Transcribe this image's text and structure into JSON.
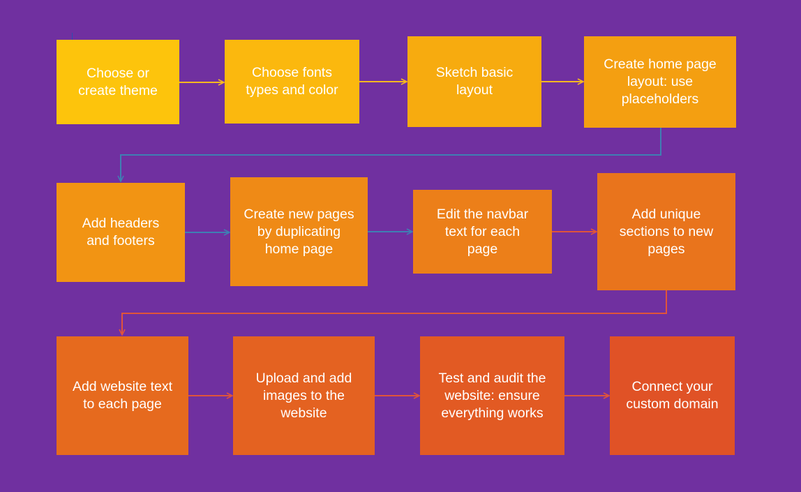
{
  "diagram": {
    "title": "",
    "background_color": "#7030a0",
    "steps": [
      {
        "id": 1,
        "label": "Choose or create theme",
        "lines": [
          "Choose or",
          "create theme"
        ],
        "color": "#fdc40c"
      },
      {
        "id": 2,
        "label": "Choose fonts types and color",
        "lines": [
          "Choose fonts",
          "types and color"
        ],
        "color": "#fbb80e"
      },
      {
        "id": 3,
        "label": "Sketch basic layout",
        "lines": [
          "Sketch basic",
          "layout"
        ],
        "color": "#f7ab0f"
      },
      {
        "id": 4,
        "label": "Create home page layout: use placeholders",
        "lines": [
          "Create home page",
          "layout: use",
          "placeholders"
        ],
        "color": "#f49f11"
      },
      {
        "id": 5,
        "label": "Add headers and footers",
        "lines": [
          "Add headers",
          "and footers"
        ],
        "color": "#f29413"
      },
      {
        "id": 6,
        "label": "Create new pages by duplicating home page",
        "lines": [
          "Create new pages",
          "by duplicating",
          "home page"
        ],
        "color": "#ef8a16"
      },
      {
        "id": 7,
        "label": "Edit the navbar text for each page",
        "lines": [
          "Edit the navbar",
          "text for each",
          "page"
        ],
        "color": "#ec7f19"
      },
      {
        "id": 8,
        "label": "Add unique sections to new pages",
        "lines": [
          "Add unique",
          "sections to new",
          "pages"
        ],
        "color": "#e9741c"
      },
      {
        "id": 9,
        "label": "Add website text to each page",
        "lines": [
          "Add website text",
          "to each page"
        ],
        "color": "#e66a1e"
      },
      {
        "id": 10,
        "label": "Upload and add images to the website",
        "lines": [
          "Upload and add",
          "images to the",
          "website"
        ],
        "color": "#e46221"
      },
      {
        "id": 11,
        "label": "Test and audit the website: ensure everything works",
        "lines": [
          "Test and audit the",
          "website: ensure",
          "everything works"
        ],
        "color": "#e25a23"
      },
      {
        "id": 12,
        "label": "Connect your custom domain",
        "lines": [
          "Connect your",
          "custom domain"
        ],
        "color": "#e05226"
      }
    ],
    "connectors": [
      {
        "from": 1,
        "to": 2,
        "color": "#f6b820"
      },
      {
        "from": 2,
        "to": 3,
        "color": "#f6b820"
      },
      {
        "from": 3,
        "to": 4,
        "color": "#f6b820"
      },
      {
        "from": 4,
        "to": 5,
        "color": "#3f7fb3"
      },
      {
        "from": 5,
        "to": 6,
        "color": "#3f7fb3"
      },
      {
        "from": 6,
        "to": 7,
        "color": "#3f7fb3"
      },
      {
        "from": 7,
        "to": 8,
        "color": "#e0543a"
      },
      {
        "from": 8,
        "to": 9,
        "color": "#e0543a"
      },
      {
        "from": 9,
        "to": 10,
        "color": "#e0543a"
      },
      {
        "from": 10,
        "to": 11,
        "color": "#e0543a"
      },
      {
        "from": 11,
        "to": 12,
        "color": "#e0543a"
      }
    ]
  }
}
